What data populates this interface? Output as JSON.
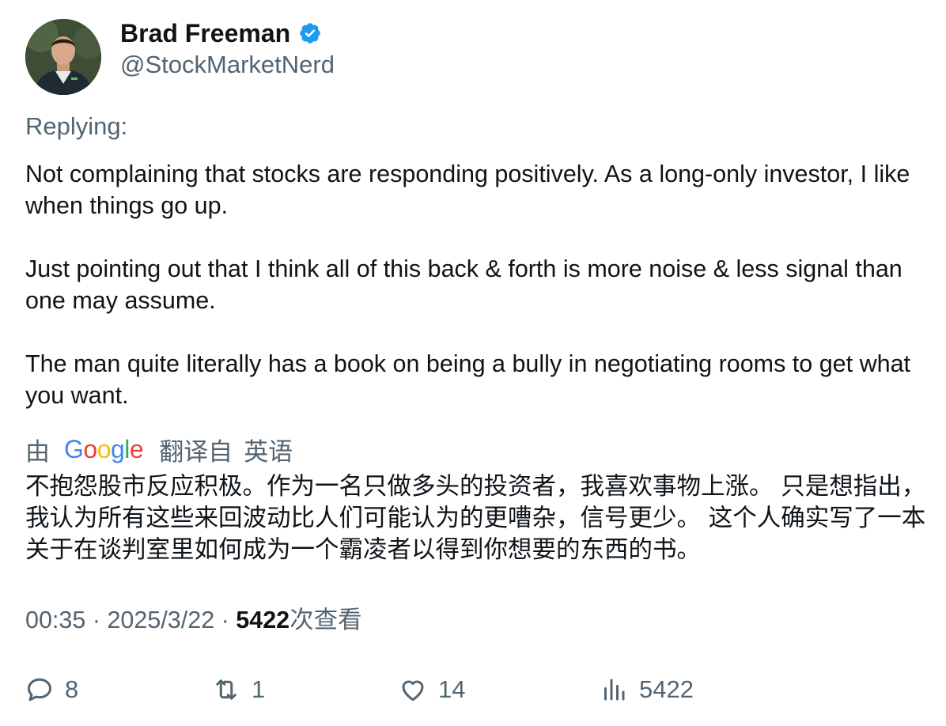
{
  "author": {
    "name": "Brad Freeman",
    "handle": "@StockMarketNerd",
    "verified_icon": "verified-badge-icon",
    "verified_color": "#1d9bf0"
  },
  "replying_label": "Replying:",
  "tweet_paragraphs": [
    "Not complaining that stocks are responding positively. As a long-only investor, I like when things go up.",
    "Just pointing out that I think all of this back & forth is more noise & less signal than one may assume.",
    "The man quite literally has a book on being a bully in negotiating rooms to get what you want."
  ],
  "translation": {
    "by_label": "由",
    "provider": "Google",
    "from_label": "翻译自",
    "language": "英语",
    "text": "不抱怨股市反应积极。作为一名只做多头的投资者，我喜欢事物上涨。 只是想指出，我认为所有这些来回波动比人们可能认为的更嘈杂，信号更少。 这个人确实写了一本关于在谈判室里如何成为一个霸凌者以得到你想要的东西的书。"
  },
  "meta": {
    "time": "00:35",
    "separator": "·",
    "date": "2025/3/22",
    "views": "5422",
    "views_label": "次查看"
  },
  "actions": {
    "replies": "8",
    "retweets": "1",
    "likes": "14",
    "views": "5422"
  },
  "colors": {
    "text": "#0f1419",
    "secondary": "#536471",
    "accent": "#1d9bf0"
  }
}
